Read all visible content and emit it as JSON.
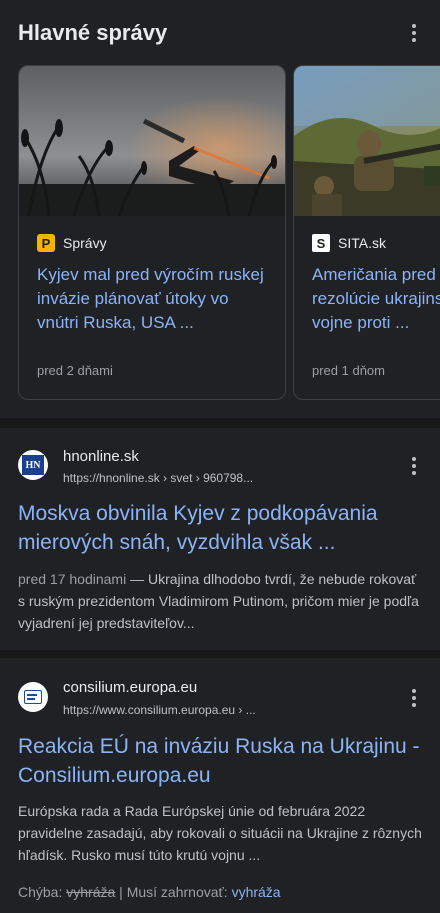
{
  "top_stories": {
    "title": "Hlavné správy",
    "cards": [
      {
        "source": "Správy",
        "favicon_letter": "P",
        "headline": "Kyjev mal pred výročím ruskej invázie plánovať útoky vo vnútri Ruska, USA ...",
        "time": "pred 2 dňami",
        "image": "rocket-launcher-silhouette"
      },
      {
        "source": "SITA.sk",
        "favicon_letter": "S",
        "headline": "Američania pred návrh rezolúcie ukrajinskom viťa vojne proti ...",
        "time": "pred 1 dňom",
        "image": "soldiers-with-gun"
      }
    ]
  },
  "results": [
    {
      "site_name": "hnonline.sk",
      "url": "https://hnonline.sk › svet › 960798...",
      "favicon_text": "HN",
      "title": "Moskva obvinila Kyjev z podkopávania mierových snáh, vyzdvihla však ...",
      "date": "pred 17 hodinami",
      "snippet": " — Ukrajina dlhodobo tvrdí, že nebude rokovať s ruským prezidentom Vladimirom Putinom, pričom mier je podľa vyjadrení jej predstaviteľov..."
    },
    {
      "site_name": "consilium.europa.eu",
      "url": "https://www.consilium.europa.eu › ...",
      "title": "Reakcia EÚ na inváziu Ruska na Ukrajinu - Consilium.europa.eu",
      "snippet": "Európska rada a Rada Európskej únie od februára 2022 pravidelne zasadajú, aby rokovali o situácii na Ukrajine z rôznych hľadísk. Rusko musí túto krutú vojnu ...",
      "missing_label": "Chýba:",
      "missing_word": "vyhráža",
      "must_include_label": "Musí zahrnovať:",
      "must_include_word": "vyhráža"
    }
  ],
  "icons": [
    "more-vert-icon"
  ],
  "colors": {
    "background": "#202124",
    "link": "#8ab4f8",
    "text": "#e8eaed",
    "muted": "#9aa0a6",
    "divider": "#171717"
  }
}
